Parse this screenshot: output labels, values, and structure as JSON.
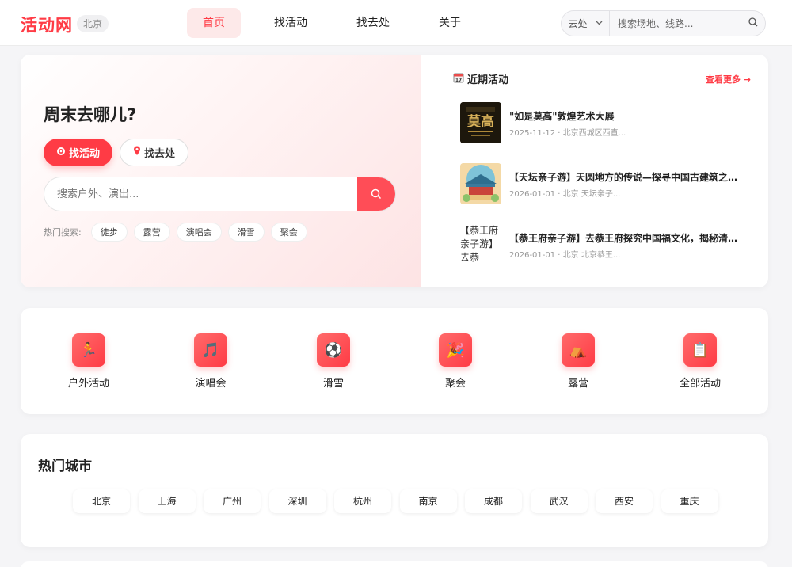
{
  "header": {
    "logo": "活动网",
    "city": "北京",
    "nav": [
      "首页",
      "找活动",
      "找去处",
      "关于"
    ],
    "search_type": "去处",
    "search_placeholder": "搜索场地、线路..."
  },
  "hero": {
    "title": "周末去哪儿?",
    "tabs": [
      "找活动",
      "找去处"
    ],
    "search_placeholder": "搜索户外、演出...",
    "hot_label": "热门搜索:",
    "hot_tags": [
      "徒步",
      "露营",
      "演唱会",
      "滑雪",
      "聚会"
    ]
  },
  "recent": {
    "heading": "近期活动",
    "more": "查看更多 →",
    "events": [
      {
        "title": "\"如是莫高\"敦煌艺术大展",
        "meta": "2025-11-12 · 北京西城区西直..."
      },
      {
        "title": "【天坛亲子游】天圆地方的传说—探寻中国古建筑之美、...",
        "meta": "2026-01-01 · 北京 天坛亲子..."
      },
      {
        "title": "【恭王府亲子游】去恭王府探究中国福文化，揭秘清王朝...",
        "meta": "2026-01-01 · 北京 北京恭王...",
        "thumb_alt": "【恭王府亲子游】去恭"
      }
    ]
  },
  "categories": [
    {
      "label": "户外活动",
      "icon": "runner-icon",
      "glyph": "🏃"
    },
    {
      "label": "演唱会",
      "icon": "music-note-icon",
      "glyph": "🎵"
    },
    {
      "label": "滑雪",
      "icon": "soccer-ball-icon",
      "glyph": "⚽"
    },
    {
      "label": "聚会",
      "icon": "party-popper-icon",
      "glyph": "🎉"
    },
    {
      "label": "露营",
      "icon": "tent-icon",
      "glyph": "⛺"
    },
    {
      "label": "全部活动",
      "icon": "clipboard-icon",
      "glyph": "📋"
    }
  ],
  "cities": {
    "title": "热门城市",
    "items": [
      "北京",
      "上海",
      "广州",
      "深圳",
      "杭州",
      "南京",
      "成都",
      "武汉",
      "西安",
      "重庆"
    ]
  },
  "colors": {
    "accent": "#ff3b45"
  }
}
